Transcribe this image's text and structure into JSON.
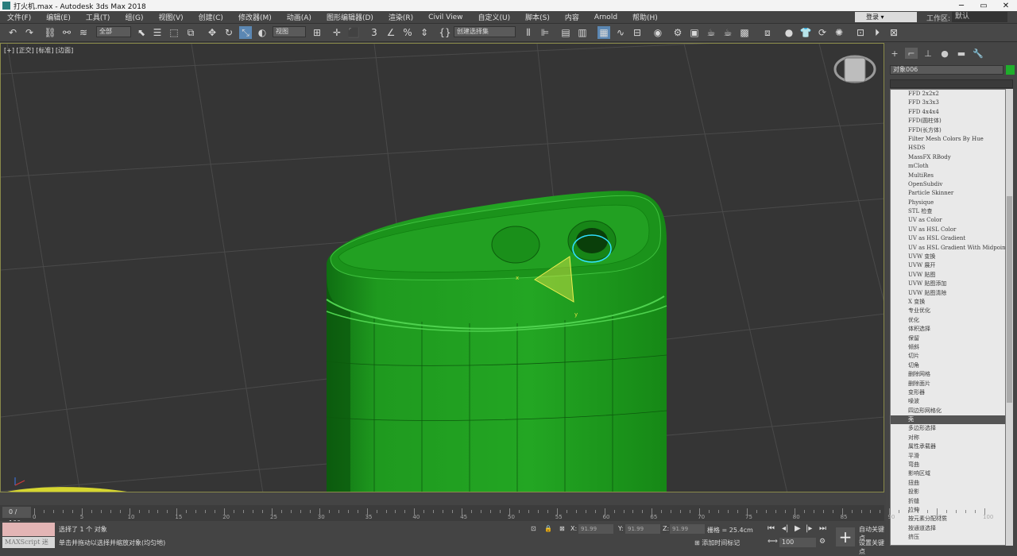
{
  "window": {
    "title": "打火机.max - Autodesk 3ds Max 2018"
  },
  "menu": [
    "文件(F)",
    "编辑(E)",
    "工具(T)",
    "组(G)",
    "视图(V)",
    "创建(C)",
    "修改器(M)",
    "动画(A)",
    "图形编辑器(D)",
    "渲染(R)",
    "Civil View",
    "自定义(U)",
    "脚本(S)",
    "内容",
    "Arnold",
    "帮助(H)"
  ],
  "login": "登录",
  "workspace": {
    "label": "工作区:",
    "value": "默认"
  },
  "toolbar": {
    "filter": "全部",
    "refcoord": "视图",
    "named_sel": "创建选择集"
  },
  "viewport": {
    "label": "[+] [正交] [标准] [边面]"
  },
  "command_panel": {
    "object_name": "对象006",
    "object_color": "#1fae2b",
    "modifiers": [
      "FFD 2x2x2",
      "FFD 3x3x3",
      "FFD 4x4x4",
      "FFD(圆柱体)",
      "FFD(长方体)",
      "Filter Mesh Colors By Hue",
      "HSDS",
      "MassFX RBody",
      "mCloth",
      "MultiRes",
      "OpenSubdiv",
      "Particle Skinner",
      "Physique",
      "STL 检查",
      "UV as Color",
      "UV as HSL Color",
      "UV as HSL Gradient",
      "UV as HSL Gradient With Midpoint",
      "UVW 变换",
      "UVW 展开",
      "UVW 贴图",
      "UVW 贴图添加",
      "UVW 贴图清除",
      "X 变换",
      "专业优化",
      "优化",
      "体积选择",
      "保留",
      "倾斜",
      "切片",
      "切角",
      "删除网格",
      "删除面片",
      "变形器",
      "噪波",
      "四边形网格化",
      "壳",
      "多边形选择",
      "对称",
      "属性承载器",
      "平滑",
      "弯曲",
      "影响区域",
      "扭曲",
      "投影",
      "折缝",
      "拉伸",
      "按元素分配材质",
      "按通道选择",
      "挤压"
    ],
    "selected_index": 36
  },
  "timeline": {
    "frame": "0 / 100",
    "ticks": [
      "0",
      "5",
      "10",
      "15",
      "20",
      "25",
      "30",
      "35",
      "40",
      "45",
      "50",
      "55",
      "60",
      "65",
      "70",
      "75",
      "80",
      "85",
      "90",
      "95",
      "100"
    ]
  },
  "status": {
    "maxscript": "MAXScript 迷",
    "selected": "选择了 1 个 对象",
    "prompt": "单击并拖动以选择并缩放对象(均匀地)",
    "x_label": "X:",
    "x": "91.99",
    "y_label": "Y:",
    "y": "91.99",
    "z_label": "Z:",
    "z": "91.99",
    "grid": "栅格 = 25.4cm",
    "add_time_tag": "添加时间标记",
    "frame_input": "100",
    "auto_key": "自动关键点",
    "set_key": "设置关键点"
  }
}
